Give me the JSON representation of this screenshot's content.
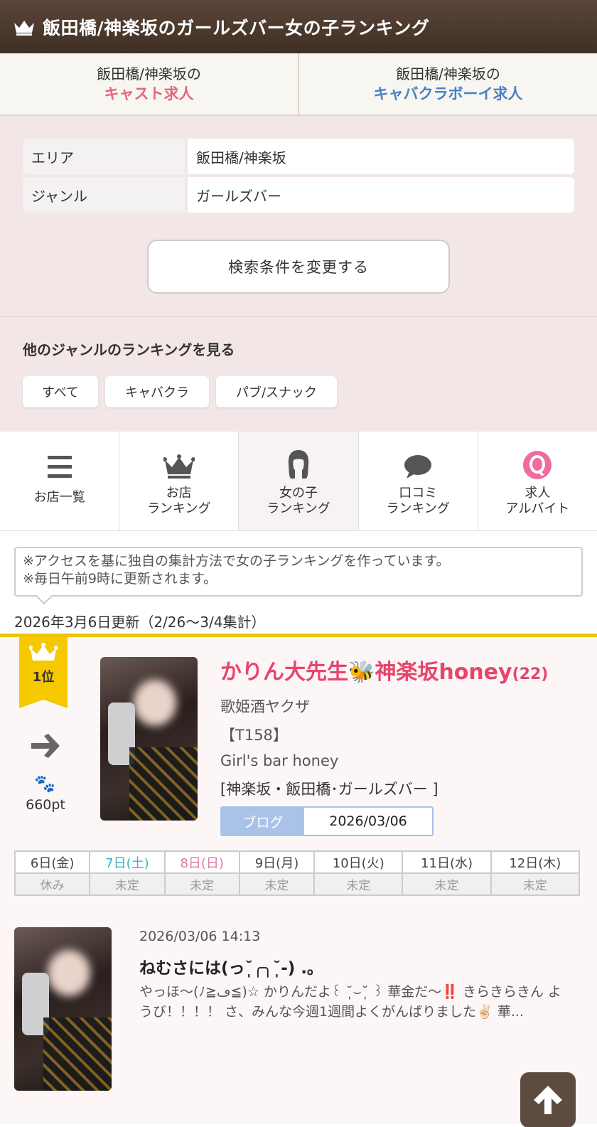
{
  "header": {
    "title": "飯田橋/神楽坂のガールズバー女の子ランキング",
    "icon": "crown-icon"
  },
  "recruit": [
    {
      "line1": "飯田橋/神楽坂の",
      "line2": "キャスト求人",
      "color": "#e5647b"
    },
    {
      "line1": "飯田橋/神楽坂の",
      "line2": "キャバクラボーイ求人",
      "color": "#4a80c4"
    }
  ],
  "conditions": {
    "area_label": "エリア",
    "area_value": "飯田橋/神楽坂",
    "genre_label": "ジャンル",
    "genre_value": "ガールズバー",
    "change_button": "検索条件を変更する"
  },
  "other_genres": {
    "title": "他のジャンルのランキングを見る",
    "chips": [
      "すべて",
      "キャバクラ",
      "パブ/スナック"
    ]
  },
  "tabs": [
    {
      "label1": "お店一覧",
      "label2": "",
      "icon": "list-icon"
    },
    {
      "label1": "お店",
      "label2": "ランキング",
      "icon": "crown-icon"
    },
    {
      "label1": "女の子",
      "label2": "ランキング",
      "icon": "girl-icon",
      "active": true
    },
    {
      "label1": "口コミ",
      "label2": "ランキング",
      "icon": "speech-bubble-icon"
    },
    {
      "label1": "求人",
      "label2": "アルバイト",
      "icon": "q-icon"
    }
  ],
  "notice": {
    "line1": "※アクセスを基に独自の集計方法で女の子ランキングを作っています。",
    "line2": "※毎日午前9時に更新されます。"
  },
  "updated": "2026年3月6日更新（2/26〜3/4集計）",
  "ranking": {
    "rank_label": "1位",
    "trend": "up-arrow",
    "points": "660pt",
    "name": "かりん大先生🐝神楽坂honey",
    "age": "(22)",
    "catch": "歌姫酒ヤクザ",
    "height": "【T158】",
    "shop": "Girl's bar honey",
    "area": "[神楽坂・飯田橋･ガールズバー ]",
    "blog_label": "ブログ",
    "blog_date": "2026/03/06",
    "schedule_days": [
      "6日(金)",
      "7日(土)",
      "8日(日)",
      "9日(月)",
      "10日(火)",
      "11日(水)",
      "12日(木)"
    ],
    "schedule_status": [
      "休み",
      "未定",
      "未定",
      "未定",
      "未定",
      "未定",
      "未定"
    ]
  },
  "post": {
    "date": "2026/03/06 14:13",
    "title": "ねむさには(っ˘̩╭╮˘̩-) .｡",
    "body": "やっほ〜(ﾉ≧ڡ≦)☆ かりんだよ꒰ ˘̩̩̩⌣˘̩̩̩ ꒱ 華金だ〜‼️ きらきらきん ようび！！！！ さ、みんな今週1週間よくがんばりました✌🏻 華..."
  },
  "colors": {
    "header_bg": "#4b3a2e",
    "accent_yellow": "#f5c800",
    "name_pink": "#e5466c",
    "blog_blue": "#a9c3e8"
  }
}
